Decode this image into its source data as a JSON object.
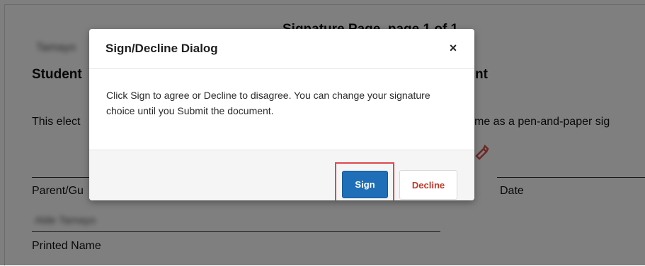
{
  "document": {
    "heading": "Signature Page, page 1 of 1",
    "blurred_name": "Tamayo",
    "section_title_start": "Student",
    "section_title_end": "nt",
    "paragraph_start": "This elect",
    "paragraph_end": "me as a pen-and-paper sig",
    "parent_label": "Parent/Gu",
    "date_label": "Date",
    "printed_name_value": "Alde Tamayo",
    "printed_name_label": "Printed Name"
  },
  "dialog": {
    "title": "Sign/Decline Dialog",
    "close_glyph": "×",
    "message": "Click Sign to agree or Decline to disagree. You can change your signature choice until you Submit the document.",
    "sign_label": "Sign",
    "decline_label": "Decline"
  },
  "colors": {
    "sign_button": "#1e6fb8",
    "decline_text": "#c0392b",
    "highlight": "#e0474f",
    "marker": "#d9534f"
  },
  "icons": {
    "close": "close-icon",
    "sign_marker": "pen-marker-icon"
  }
}
